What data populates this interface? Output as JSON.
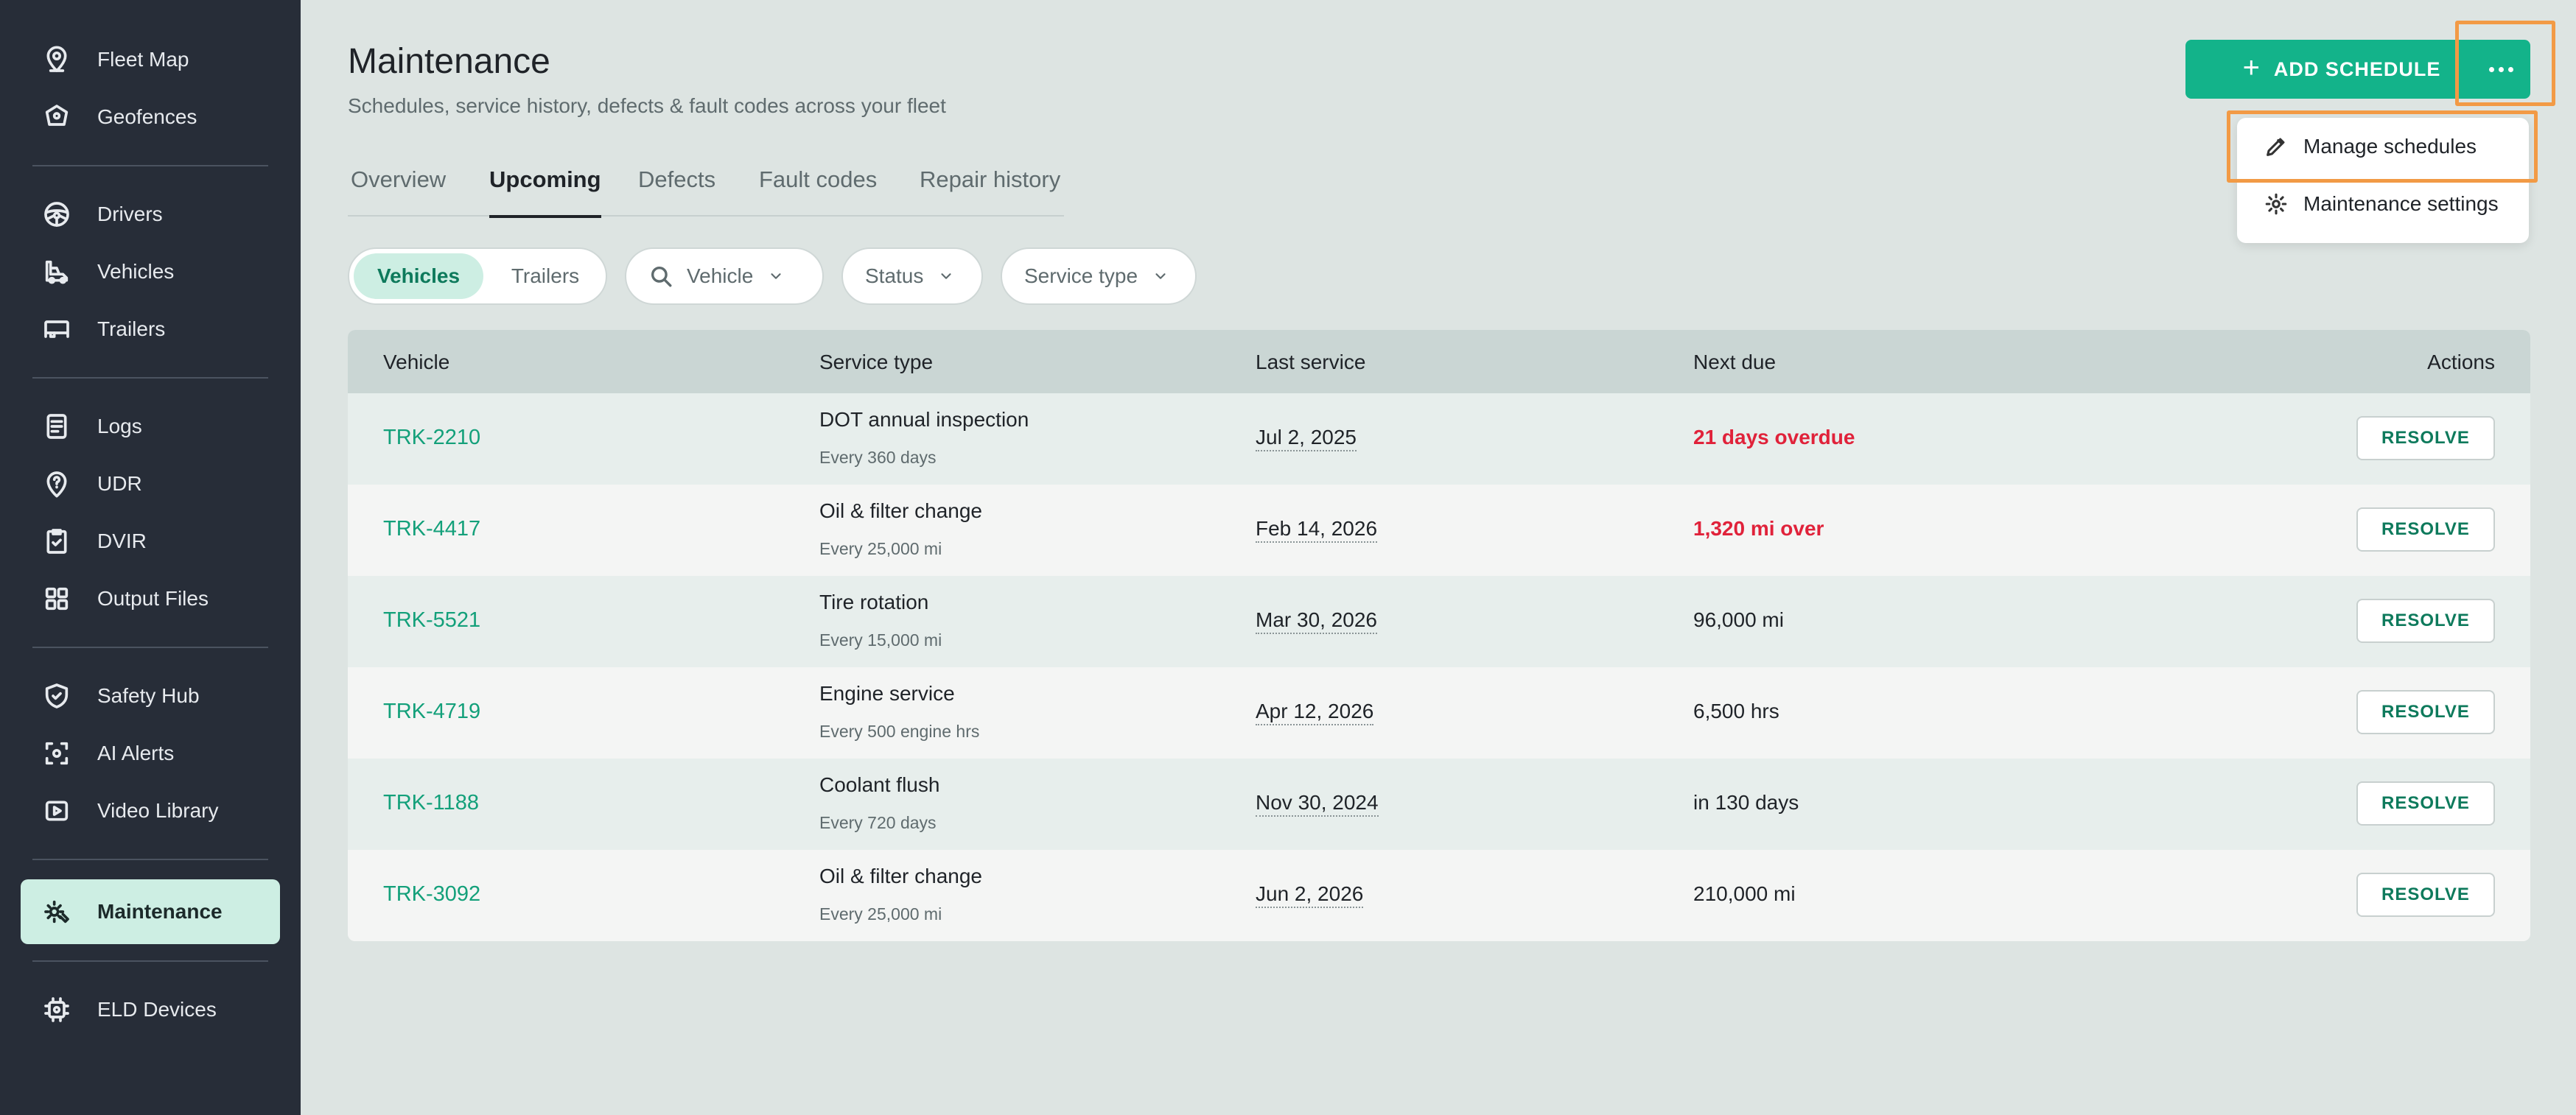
{
  "sidebar": {
    "items": [
      {
        "label": "Fleet Map",
        "icon": "map-pin-icon"
      },
      {
        "label": "Geofences",
        "icon": "geofence-icon"
      },
      {
        "label": "Drivers",
        "icon": "steering-wheel-icon"
      },
      {
        "label": "Vehicles",
        "icon": "truck-icon"
      },
      {
        "label": "Trailers",
        "icon": "trailer-icon"
      },
      {
        "label": "Logs",
        "icon": "logs-icon"
      },
      {
        "label": "UDR",
        "icon": "question-pin-icon"
      },
      {
        "label": "DVIR",
        "icon": "clipboard-check-icon"
      },
      {
        "label": "Output Files",
        "icon": "grid-icon"
      },
      {
        "label": "Safety Hub",
        "icon": "shield-check-icon"
      },
      {
        "label": "AI Alerts",
        "icon": "camera-scan-icon"
      },
      {
        "label": "Video Library",
        "icon": "video-icon"
      },
      {
        "label": "Maintenance",
        "icon": "maintenance-icon",
        "active": true
      },
      {
        "label": "ELD Devices",
        "icon": "device-icon"
      }
    ]
  },
  "header": {
    "title": "Maintenance",
    "subtitle": "Schedules, service history, defects & fault codes across your fleet",
    "add_button": "ADD SCHEDULE",
    "more_icon": "more-horizontal-icon"
  },
  "menu": {
    "items": [
      {
        "label": "Manage schedules",
        "icon": "pencil-icon"
      },
      {
        "label": "Maintenance settings",
        "icon": "gear-icon"
      }
    ]
  },
  "tabs": [
    {
      "label": "Overview"
    },
    {
      "label": "Upcoming",
      "active": true
    },
    {
      "label": "Defects"
    },
    {
      "label": "Fault codes"
    },
    {
      "label": "Repair history"
    }
  ],
  "filters": {
    "segment": {
      "vehicles": "Vehicles",
      "trailers": "Trailers",
      "selected": "Vehicles"
    },
    "vehicle": "Vehicle",
    "status": "Status",
    "service_type": "Service type"
  },
  "table": {
    "columns": {
      "vehicle": "Vehicle",
      "service_type": "Service type",
      "last_service": "Last service",
      "next_due": "Next due",
      "actions": "Actions"
    },
    "action_label": "RESOLVE",
    "rows": [
      {
        "vehicle": "TRK-2210",
        "service": "DOT annual inspection",
        "interval": "Every 360 days",
        "last": "Jul 2, 2025",
        "due": "21 days overdue",
        "overdue": true
      },
      {
        "vehicle": "TRK-4417",
        "service": "Oil & filter change",
        "interval": "Every 25,000 mi",
        "last": "Feb 14, 2026",
        "due": "1,320 mi over",
        "overdue": true
      },
      {
        "vehicle": "TRK-5521",
        "service": "Tire rotation",
        "interval": "Every 15,000 mi",
        "last": "Mar 30, 2026",
        "due": "96,000 mi",
        "overdue": false
      },
      {
        "vehicle": "TRK-4719",
        "service": "Engine service",
        "interval": "Every 500 engine hrs",
        "last": "Apr 12, 2026",
        "due": "6,500 hrs",
        "overdue": false
      },
      {
        "vehicle": "TRK-1188",
        "service": "Coolant flush",
        "interval": "Every 720 days",
        "last": "Nov 30, 2024",
        "due": "in 130 days",
        "overdue": false
      },
      {
        "vehicle": "TRK-3092",
        "service": "Oil & filter change",
        "interval": "Every 25,000 mi",
        "last": "Jun 2, 2026",
        "due": "210,000 mi",
        "overdue": false
      }
    ]
  },
  "colors": {
    "accent": "#13b38a",
    "overdue": "#e0223a",
    "sidebar_bg": "#272d38",
    "active_nav_bg": "#cdeee3",
    "highlight": "#f29a45"
  }
}
